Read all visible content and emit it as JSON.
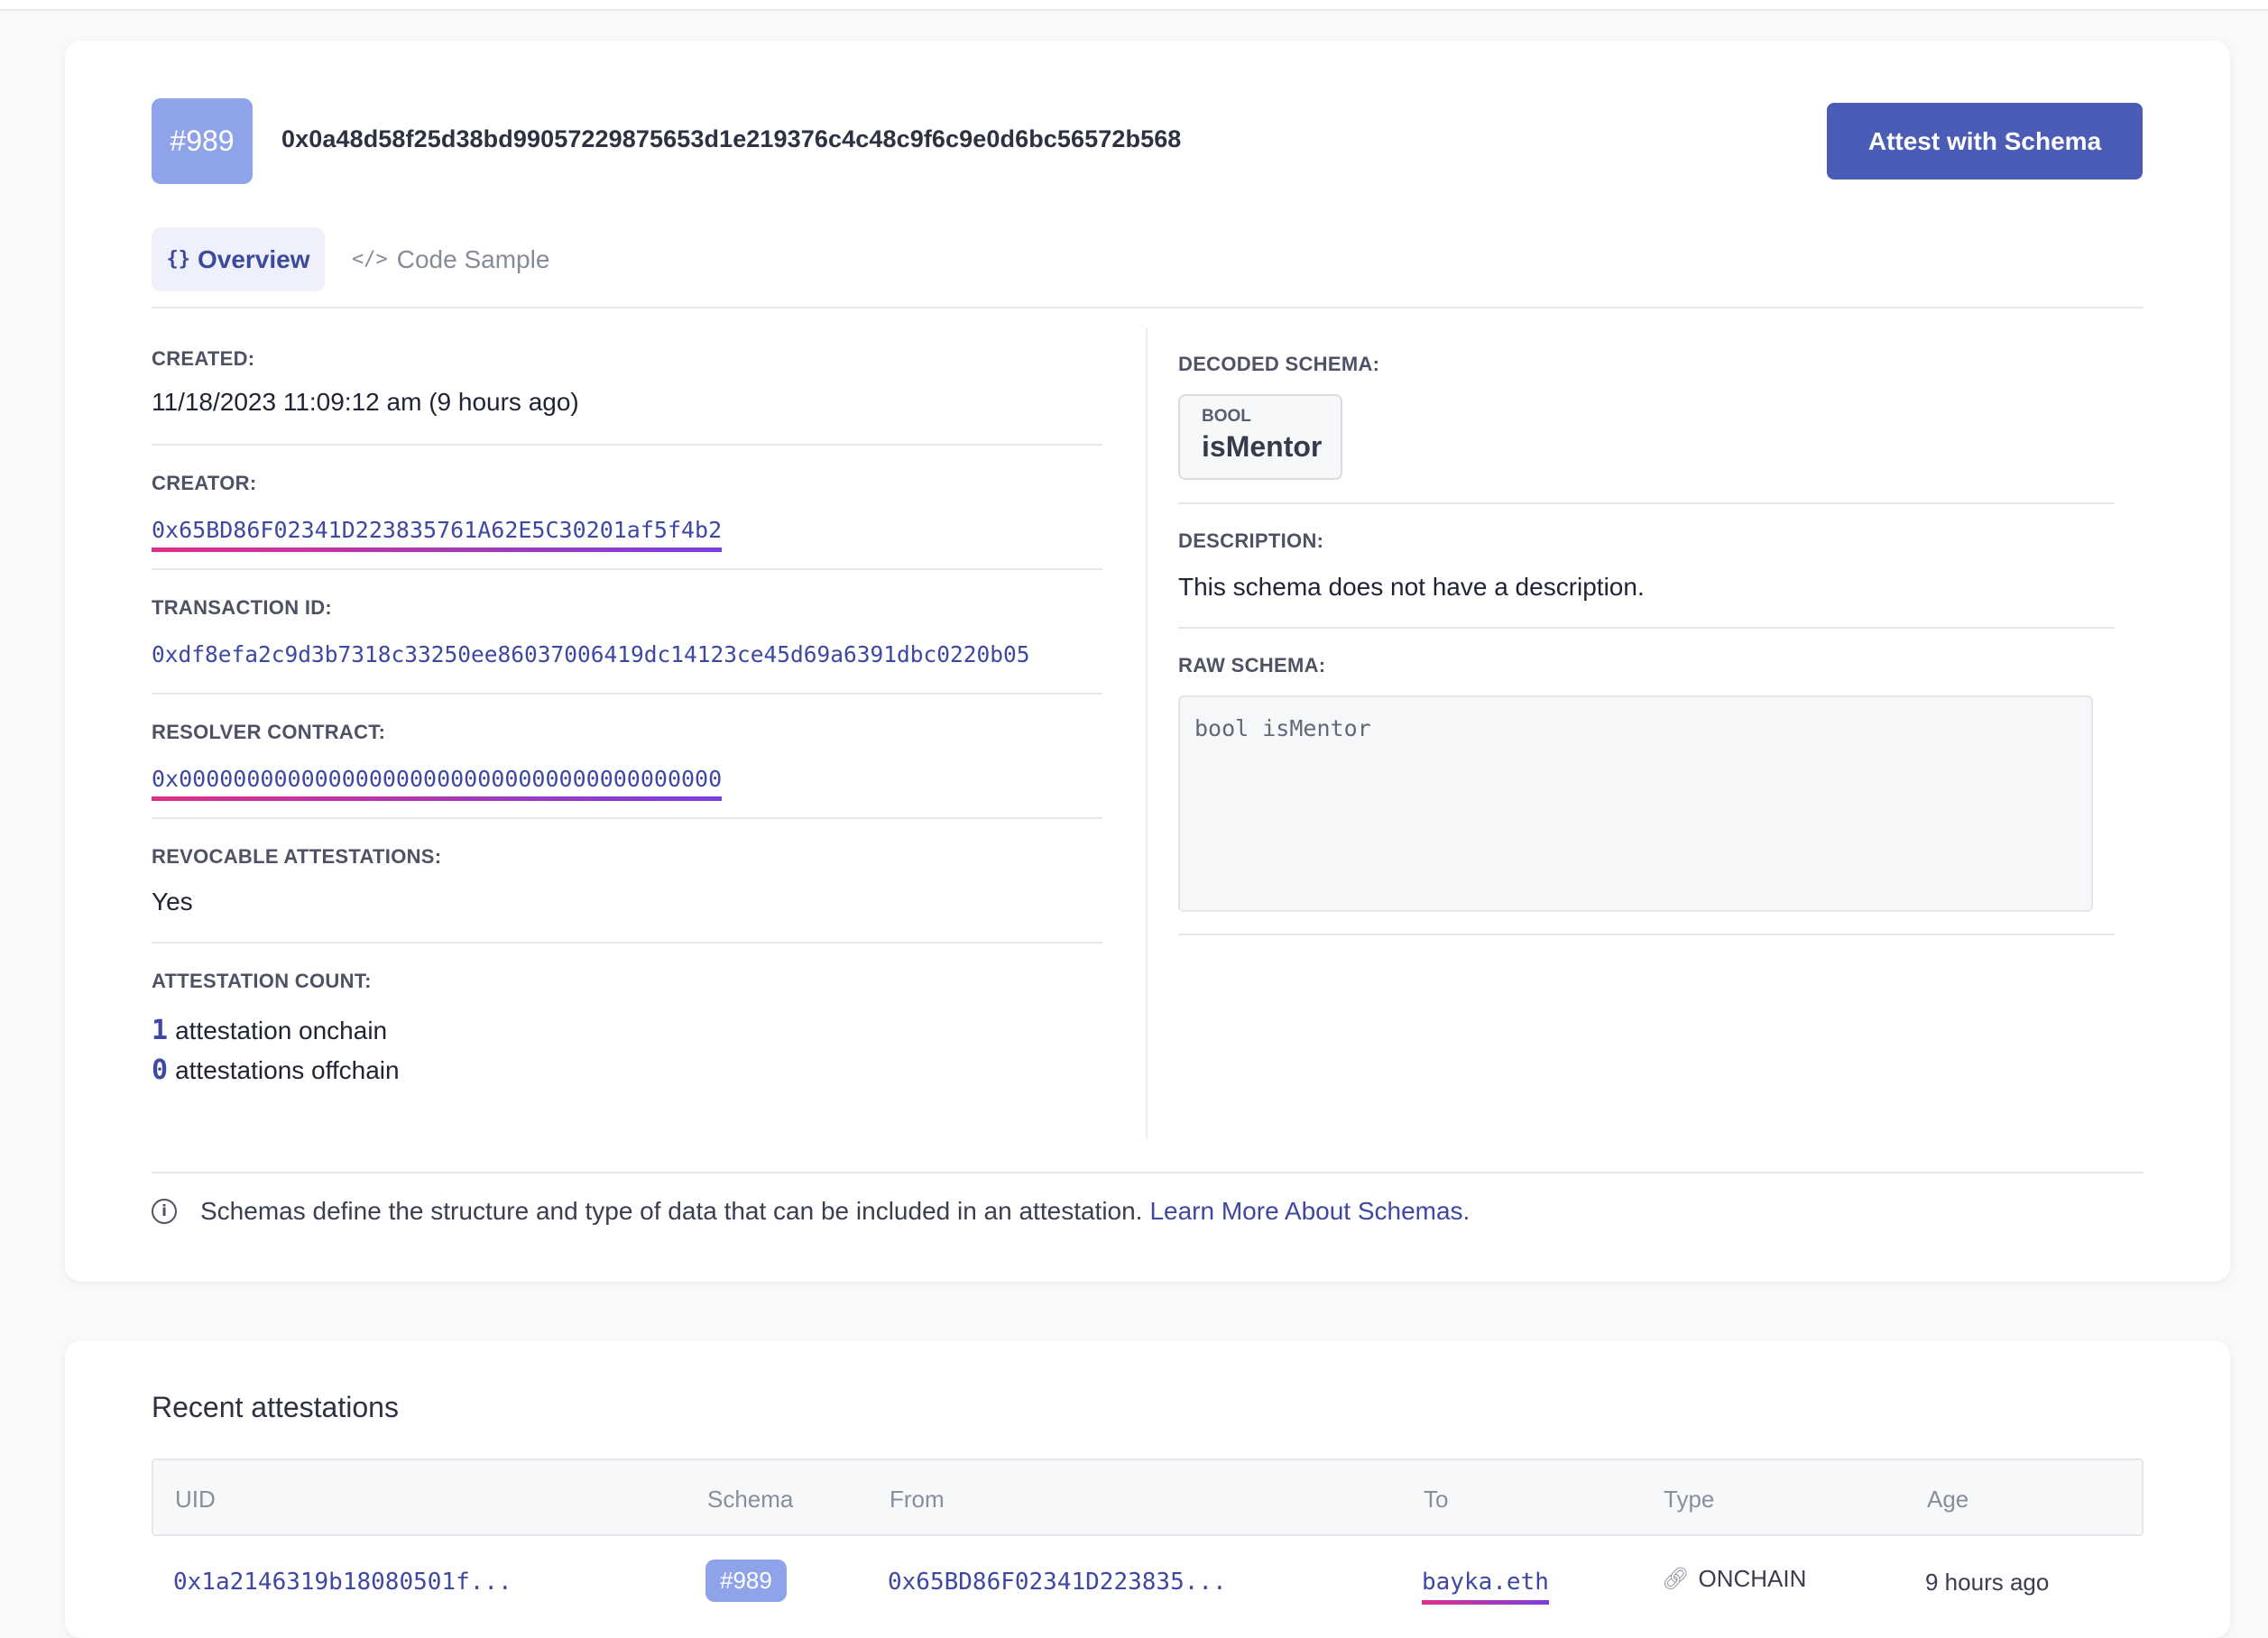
{
  "schema": {
    "number": "#989",
    "uid": "0x0a48d58f25d38bd99057229875653d1e219376c4c48c9f6c9e0d6bc56572b568",
    "attest_button": "Attest with Schema"
  },
  "tabs": [
    {
      "label": "Overview",
      "icon": "{}",
      "active": true
    },
    {
      "label": "Code Sample",
      "icon": "</>",
      "active": false
    }
  ],
  "details": {
    "created_label": "CREATED:",
    "created_value": "11/18/2023 11:09:12 am (9 hours ago)",
    "creator_label": "CREATOR:",
    "creator_value": "0x65BD86F02341D223835761A62E5C30201af5f4b2",
    "txid_label": "TRANSACTION ID:",
    "txid_value": "0xdf8efa2c9d3b7318c33250ee86037006419dc14123ce45d69a6391dbc0220b05",
    "resolver_label": "RESOLVER CONTRACT:",
    "resolver_value": "0x0000000000000000000000000000000000000000",
    "revocable_label": "REVOCABLE ATTESTATIONS:",
    "revocable_value": "Yes",
    "count_label": "ATTESTATION COUNT:",
    "onchain_count": "1",
    "onchain_text": "attestation onchain",
    "offchain_count": "0",
    "offchain_text": "attestations offchain"
  },
  "right": {
    "decoded_label": "DECODED SCHEMA:",
    "field_type": "BOOL",
    "field_name": "isMentor",
    "description_label": "DESCRIPTION:",
    "description_value": "This schema does not have a description.",
    "raw_label": "RAW SCHEMA:",
    "raw_value": "bool isMentor"
  },
  "info": {
    "text": "Schemas define the structure and type of data that can be included in an attestation.",
    "link": "Learn More About Schemas."
  },
  "recent": {
    "title": "Recent attestations",
    "columns": [
      "UID",
      "Schema",
      "From",
      "To",
      "Type",
      "Age"
    ],
    "rows": [
      {
        "uid": "0x1a2146319b18080501f...",
        "schema": "#989",
        "from": "0x65BD86F02341D223835...",
        "to": "bayka.eth",
        "type": "ONCHAIN",
        "age": "9 hours ago"
      }
    ]
  }
}
